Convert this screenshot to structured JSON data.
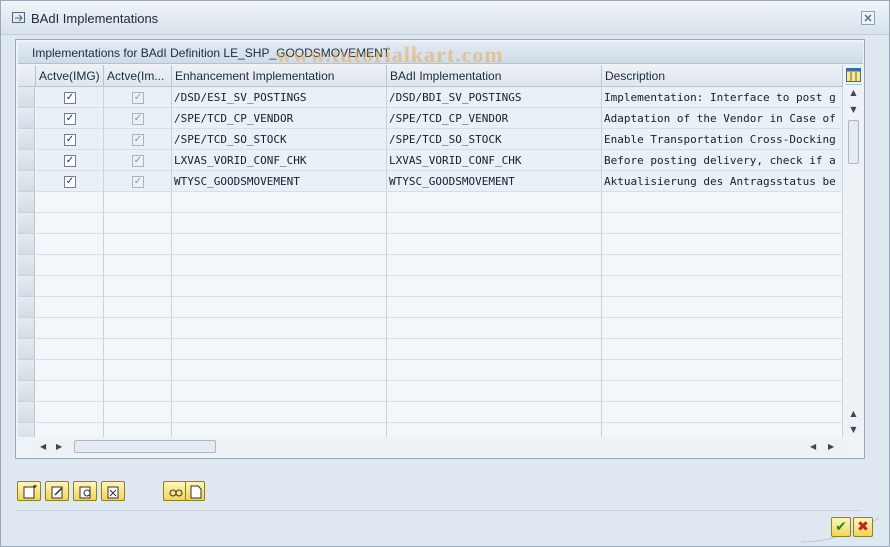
{
  "window": {
    "title": "BAdI Implementations",
    "close_icon": "close-icon"
  },
  "group": {
    "title": "Implementations for BAdI Definition LE_SHP_GOODSMOVEMENT",
    "watermark": "www.tutorialkart.com"
  },
  "table": {
    "columns": [
      "Actve(IMG)",
      "Actve(Im...",
      "Enhancement Implementation",
      "BAdI Implementation",
      "Description"
    ],
    "rows": [
      {
        "active_img": true,
        "active_impl": true,
        "enh": "/DSD/ESI_SV_POSTINGS",
        "badi": "/DSD/BDI_SV_POSTINGS",
        "desc": "Implementation: Interface to post g"
      },
      {
        "active_img": true,
        "active_impl": true,
        "enh": "/SPE/TCD_CP_VENDOR",
        "badi": "/SPE/TCD_CP_VENDOR",
        "desc": "Adaptation of the Vendor in Case of"
      },
      {
        "active_img": true,
        "active_impl": true,
        "enh": "/SPE/TCD_SO_STOCK",
        "badi": "/SPE/TCD_SO_STOCK",
        "desc": "Enable Transportation Cross-Docking"
      },
      {
        "active_img": true,
        "active_impl": true,
        "enh": "LXVAS_VORID_CONF_CHK",
        "badi": "LXVAS_VORID_CONF_CHK",
        "desc": "Before posting delivery, check if a"
      },
      {
        "active_img": true,
        "active_impl": true,
        "enh": "WTYSC_GOODSMOVEMENT",
        "badi": "WTYSC_GOODSMOVEMENT",
        "desc": "Aktualisierung des Antragsstatus be"
      }
    ],
    "empty_row_count": 12
  },
  "toolbar": {
    "icons": [
      "create-icon",
      "change-icon",
      "display-icon",
      "delete-icon"
    ],
    "extra_icons": [
      "find-icon",
      "document-icon"
    ]
  },
  "footer": {
    "ok_icon": "checkmark-icon",
    "cancel_icon": "cancel-icon"
  },
  "colors": {
    "accent": "#f1d45a",
    "grid_bg": "#e9f0f8",
    "window_bg": "#dfe8f1"
  }
}
